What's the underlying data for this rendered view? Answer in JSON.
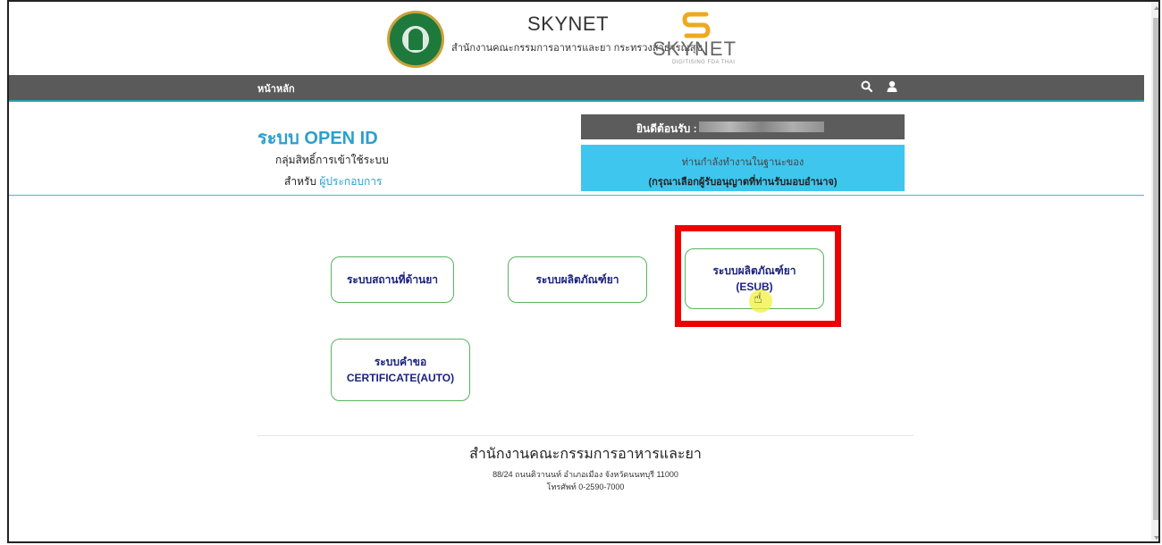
{
  "header": {
    "site_title": "SKYNET",
    "agency_subtitle": "สำนักงานคณะกรรมการอาหารและยา กระทรวงสาธารณสุข",
    "logo_word": "SKYNET",
    "logo_tagline": "DIGITISING FDA THAI",
    "seal_icon": "ministry-seal-icon"
  },
  "nav": {
    "home_label": "หน้าหลัก",
    "icons": [
      "search-icon",
      "user-icon"
    ]
  },
  "info": {
    "system_title": "ระบบ OPEN ID",
    "group_label": "กลุ่มสิทธิ์การเข้าใช้ระบบ",
    "for_label": "สำหรับ",
    "for_role": "ผู้ประกอบการ",
    "welcome_label": "ยินดีต้อนรับ :",
    "acting_as": "ท่านกำลังทำงานในฐานะของ",
    "select_licensee": "(กรุณาเลือกผู้รับอนุญาตที่ท่านรับมอบอำนาจ)"
  },
  "systems": [
    {
      "line1": "ระบบสถานที่ด้านยา",
      "line2": ""
    },
    {
      "line1": "ระบบผลิตภัณฑ์ยา",
      "line2": ""
    },
    {
      "line1": "ระบบผลิตภัณฑ์ยา",
      "line2": "(ESUB)"
    },
    {
      "line1": "ระบบคำขอ",
      "line2": "CERTIFICATE(AUTO)"
    }
  ],
  "footer": {
    "org_name": "สำนักงานคณะกรรมการอาหารและยา",
    "address": "88/24 ถนนติวานนท์ อำเภอเมือง จังหวัดนนทบุรี 11000",
    "phone": "โทรศัพท์ 0-2590-7000"
  },
  "colors": {
    "accent_blue": "#2a9fd0",
    "nav_gray": "#5a5a5a",
    "role_cyan": "#3fc6ee",
    "button_border": "#59b35f",
    "highlight_red": "#ee0000"
  }
}
